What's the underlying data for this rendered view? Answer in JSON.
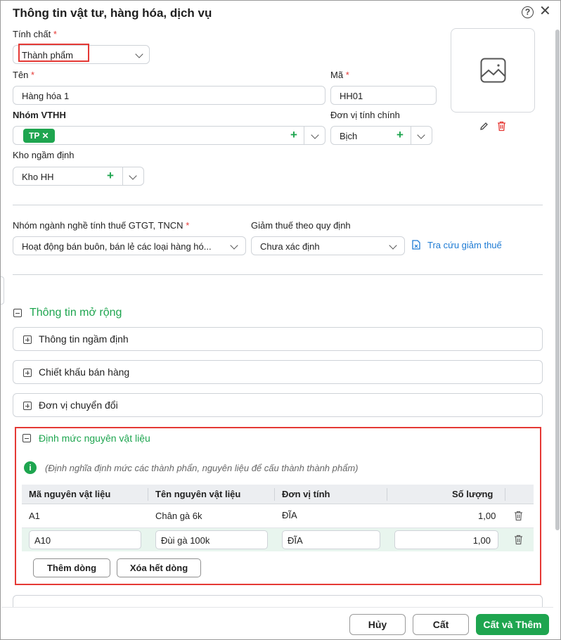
{
  "dialog": {
    "title": "Thông tin vật tư, hàng hóa, dịch vụ",
    "help_label": "?",
    "close_label": "✕"
  },
  "form": {
    "tinh_chat_label": "Tính chất",
    "tinh_chat_value": "Thành phẩm",
    "ten_label": "Tên",
    "ten_value": "Hàng hóa 1",
    "ma_label": "Mã",
    "ma_value": "HH01",
    "nhom_label": "Nhóm VTHH",
    "nhom_chip": "TP",
    "dvt_label": "Đơn vị tính chính",
    "dvt_value": "Bịch",
    "kho_label": "Kho ngầm định",
    "kho_value": "Kho HH",
    "required_mark": "*",
    "remove_chip": "✕",
    "plus": "+"
  },
  "tax": {
    "nhom_nganh_label": "Nhóm ngành nghề tính thuế GTGT, TNCN",
    "nhom_nganh_value": "Hoạt động bán buôn, bán lẻ các loại hàng hó...",
    "giam_thue_label": "Giảm thuế theo quy định",
    "giam_thue_value": "Chưa xác định",
    "lookup_link": "Tra cứu giảm thuế"
  },
  "extended": {
    "title": "Thông tin mở rộng",
    "panels": [
      {
        "label": "Thông tin ngầm định"
      },
      {
        "label": "Chiết khấu bán hàng"
      },
      {
        "label": "Đơn vị chuyển đổi"
      }
    ]
  },
  "bom": {
    "title": "Định mức nguyên vật liệu",
    "info_glyph": "i",
    "note": "(Định nghĩa định mức các thành phẩn, nguyên liệu để cấu thành thành phẩm)",
    "columns": [
      "Mã nguyên vật liệu",
      "Tên nguyên vật liệu",
      "Đơn vị tính",
      "Số lượng"
    ],
    "rows": [
      {
        "code": "A1",
        "name": "Chân gà 6k",
        "unit": "ĐĨA",
        "qty": "1,00"
      },
      {
        "code": "A10",
        "name": "Đùi gà 100k",
        "unit": "ĐĨA",
        "qty": "1,00"
      }
    ],
    "add_row_label": "Thêm dòng",
    "clear_rows_label": "Xóa hết dòng"
  },
  "footer": {
    "cancel_label": "Hủy",
    "save_label": "Cất",
    "save_add_label": "Cất và Thêm"
  },
  "colors": {
    "accent": "#1ea54f",
    "required": "#e53935",
    "link": "#1e7bd4"
  }
}
